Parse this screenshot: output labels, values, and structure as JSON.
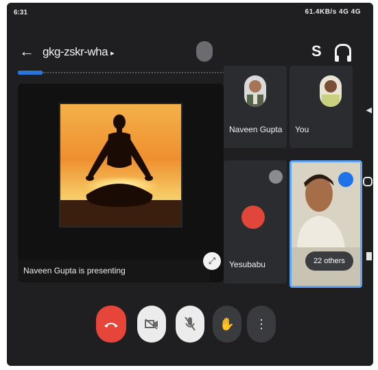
{
  "status_bar": {
    "time": "6:31",
    "right_text": "61.4KB/s  4G  4G"
  },
  "meeting": {
    "code": "gkg-zskr-wha",
    "swap_glyph": "S"
  },
  "presentation": {
    "label": "Naveen Gupta is presenting"
  },
  "participants": [
    {
      "name": "Naveen Gupta"
    },
    {
      "name": "You"
    },
    {
      "name": "Yesubabu"
    }
  ],
  "others_label": "22 others",
  "controls": {
    "end_call_icon": "phone-hangup-icon",
    "camera_off_icon": "camera-off-icon",
    "mic_off_icon": "mic-off-icon",
    "raise_hand_icon": "raise-hand-icon",
    "more_icon": "more-vert-icon"
  },
  "colors": {
    "end_call": "#e6453a",
    "accent_blue": "#1f73e8",
    "active_tile_border": "#5fa5f5",
    "background": "#1f1f21"
  }
}
